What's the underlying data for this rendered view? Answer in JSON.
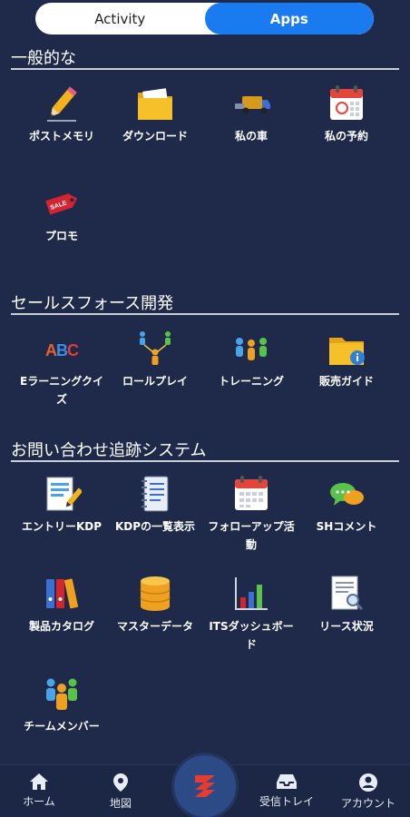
{
  "tabs": [
    {
      "label": "Activity",
      "active": false
    },
    {
      "label": "Apps",
      "active": true
    }
  ],
  "sections": [
    {
      "title": "一般的な",
      "items": [
        {
          "label": "ポストメモリ",
          "icon": "pencil-icon"
        },
        {
          "label": "ダウンロード",
          "icon": "folder-download-icon"
        },
        {
          "label": "私の車",
          "icon": "truck-icon"
        },
        {
          "label": "私の予約",
          "icon": "calendar-icon"
        },
        {
          "label": "プロモ",
          "icon": "sale-tag-icon"
        }
      ]
    },
    {
      "title": "セールスフォース開発",
      "items": [
        {
          "label": "Eラーニングクイズ",
          "icon": "abc-icon"
        },
        {
          "label": "ロールプレイ",
          "icon": "people-network-icon"
        },
        {
          "label": "トレーニング",
          "icon": "people-group-icon"
        },
        {
          "label": "販売ガイド",
          "icon": "folder-info-icon"
        }
      ]
    },
    {
      "title": "お問い合わせ追跡システム",
      "items": [
        {
          "label": "エントリーKDP",
          "icon": "form-edit-icon"
        },
        {
          "label": "KDPの一覧表示",
          "icon": "notebook-icon"
        },
        {
          "label": "フォローアップ活動",
          "icon": "calendar-icon"
        },
        {
          "label": "SHコメント",
          "icon": "chat-bubbles-icon"
        },
        {
          "label": "製品カタログ",
          "icon": "binders-icon"
        },
        {
          "label": "マスターデータ",
          "icon": "database-icon"
        },
        {
          "label": "ITSダッシュボード",
          "icon": "bar-chart-icon"
        },
        {
          "label": "リース状況",
          "icon": "document-search-icon"
        },
        {
          "label": "チームメンバー",
          "icon": "team-icon"
        }
      ]
    }
  ],
  "bottom_nav": [
    {
      "label": "ホーム",
      "icon": "home-icon"
    },
    {
      "label": "地図",
      "icon": "map-pin-icon"
    },
    {
      "label": "",
      "icon": "suzuki-logo-icon"
    },
    {
      "label": "受信トレイ",
      "icon": "inbox-icon"
    },
    {
      "label": "アカウント",
      "icon": "account-icon"
    }
  ],
  "colors": {
    "background": "#1f2a4b",
    "active_tab": "#1a7af0",
    "brand_red": "#e63b2e"
  }
}
